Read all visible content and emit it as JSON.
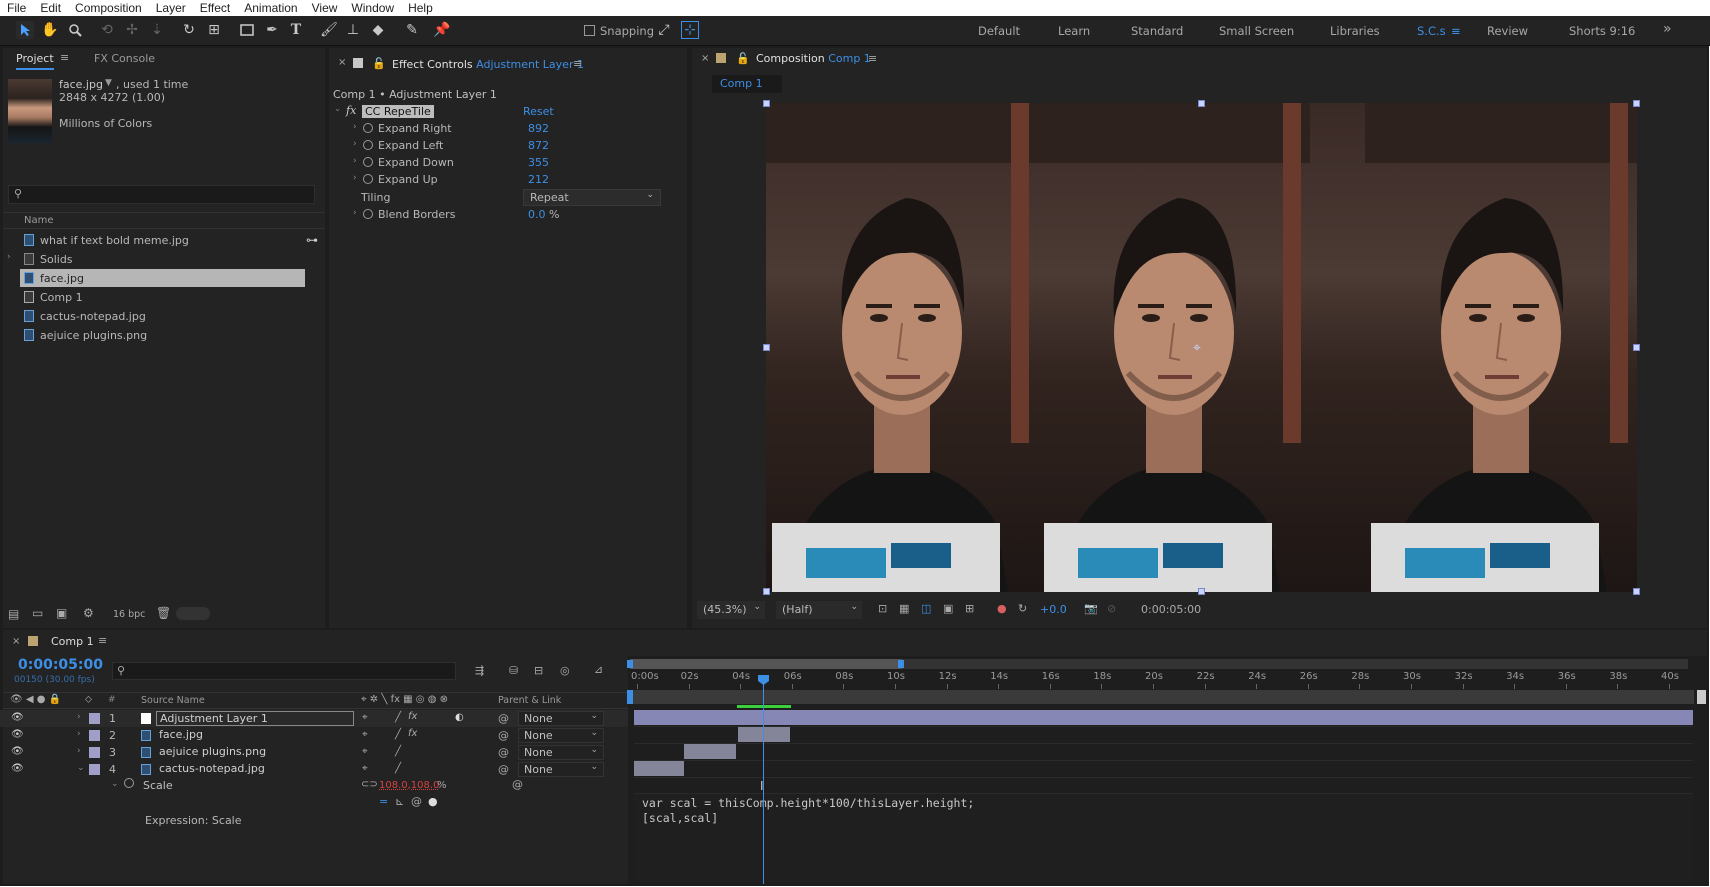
{
  "menu": [
    "File",
    "Edit",
    "Composition",
    "Layer",
    "Effect",
    "Animation",
    "View",
    "Window",
    "Help"
  ],
  "toolbar": {
    "snapping_label": "Snapping",
    "workspaces": [
      "Default",
      "Learn",
      "Standard",
      "Small Screen",
      "Libraries",
      "S.C.s",
      "Review",
      "Shorts 9:16"
    ],
    "more": "»"
  },
  "project": {
    "tabs": [
      "Project",
      "FX Console"
    ],
    "selected_name": "face.jpg",
    "used": ", used 1 time",
    "dims": "2848 x 4272 (1.00)",
    "colors": "Millions of Colors",
    "column_name": "Name",
    "items": [
      "what if text bold meme.jpg",
      "Solids",
      "face.jpg",
      "Comp 1",
      "cactus-notepad.jpg",
      "aejuice plugins.png"
    ],
    "bpc": "16 bpc"
  },
  "effect_controls": {
    "tab_prefix": "Effect Controls",
    "tab_layer": "Adjustment Layer 1",
    "breadcrumb": "Comp 1 • Adjustment Layer 1",
    "effect_name": "CC RepeTile",
    "reset": "Reset",
    "params": [
      {
        "name": "Expand Right",
        "value": "892"
      },
      {
        "name": "Expand Left",
        "value": "872"
      },
      {
        "name": "Expand Down",
        "value": "355"
      },
      {
        "name": "Expand Up",
        "value": "212"
      }
    ],
    "tiling_label": "Tiling",
    "tiling_value": "Repeat",
    "blend_label": "Blend Borders",
    "blend_value": "0.0",
    "blend_unit": "%"
  },
  "composition": {
    "tab_prefix": "Composition",
    "tab_comp": "Comp 1",
    "subtab": "Comp 1",
    "zoom": "(45.3%)",
    "resolution": "(Half)",
    "exposure": "+0.0",
    "timecode": "0:00:05:00"
  },
  "timeline": {
    "tab": "Comp 1",
    "timecode": "0:00:05:00",
    "frames": "00150 (30.00 fps)",
    "col_hash": "#",
    "col_source": "Source Name",
    "col_parent": "Parent & Link",
    "layers": [
      {
        "num": "1",
        "name": "Adjustment Layer 1",
        "parent": "None"
      },
      {
        "num": "2",
        "name": "face.jpg",
        "parent": "None"
      },
      {
        "num": "3",
        "name": "aejuice plugins.png",
        "parent": "None"
      },
      {
        "num": "4",
        "name": "cactus-notepad.jpg",
        "parent": "None"
      }
    ],
    "scale_label": "Scale",
    "scale_value": "108.0,108.0",
    "scale_unit": "%",
    "expression_label": "Expression: Scale",
    "ruler": [
      "0:00s",
      "02s",
      "04s",
      "06s",
      "08s",
      "10s",
      "12s",
      "14s",
      "16s",
      "18s",
      "20s",
      "22s",
      "24s",
      "26s",
      "28s",
      "30s",
      "32s",
      "34s",
      "36s",
      "38s",
      "40s"
    ],
    "expression_line1": "var scal = thisComp.height*100/thisLayer.height;",
    "expression_line2": "[scal,scal]"
  },
  "colors": {
    "accent": "#3d8fe6",
    "panel": "#232323",
    "bg": "#1d1d1d",
    "label": "#9f9fc8"
  }
}
